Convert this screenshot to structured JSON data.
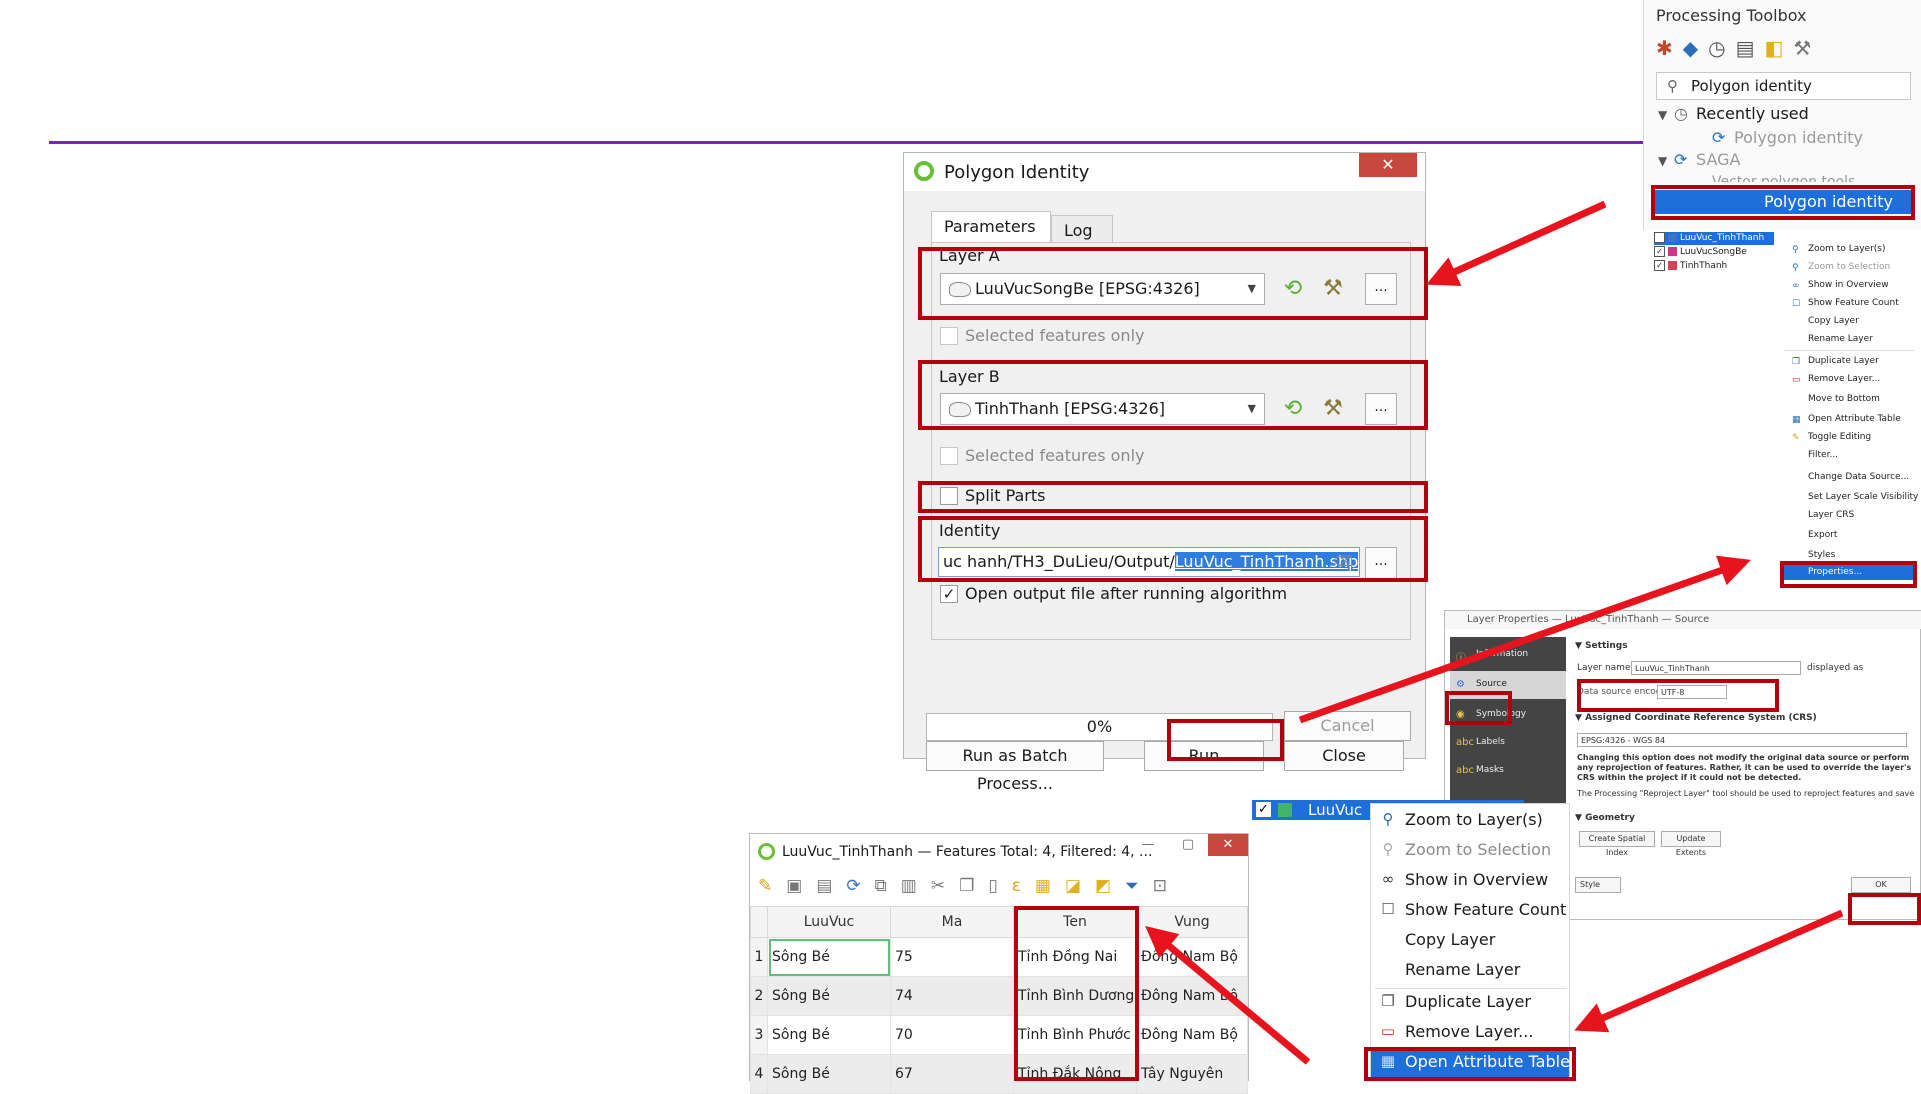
{
  "toolbox": {
    "title": "Processing Toolbox",
    "search_value": "Polygon identity",
    "recently_used": "Recently used",
    "recent_item": "Polygon identity",
    "saga": "SAGA",
    "vector_tools": "Vector polygon tools",
    "selected_item": "Polygon identity"
  },
  "layers_mini": {
    "rows": [
      "LuuVuc_TinhThanh",
      "LuuVucSongBe",
      "TinhThanh"
    ],
    "colors": [
      "#3a74c9",
      "#c33a8a",
      "#d24455"
    ]
  },
  "context_mini": {
    "items": [
      "Zoom to Layer(s)",
      "Zoom to Selection",
      "Show in Overview",
      "Show Feature Count",
      "Copy Layer",
      "Rename Layer",
      "Duplicate Layer",
      "Remove Layer...",
      "Move to Bottom",
      "Open Attribute Table",
      "Toggle Editing",
      "Filter...",
      "Change Data Source...",
      "Set Layer Scale Visibility",
      "Layer CRS",
      "Export",
      "Styles",
      "Properties..."
    ]
  },
  "dialog": {
    "title": "Polygon Identity",
    "close_glyph": "✕",
    "tabs": [
      "Parameters",
      "Log"
    ],
    "layer_a_label": "Layer A",
    "layer_a_value": "LuuVucSongBe [EPSG:4326]",
    "selected_only": "Selected features only",
    "layer_b_label": "Layer B",
    "layer_b_value": "TinhThanh [EPSG:4326]",
    "split_parts": "Split Parts",
    "identity_label": "Identity",
    "identity_path_prefix": "uc hanh/TH3_DuLieu/Output/",
    "identity_path_selected": "LuuVuc_TinhThanh.shp",
    "open_output": "Open output file after running algorithm",
    "ellipsis": "...",
    "progress": 0,
    "progress_text": "0%",
    "cancel": "Cancel",
    "run_batch": "Run as Batch Process...",
    "run": "Run",
    "close": "Close"
  },
  "attribute_table": {
    "title": "LuuVuc_TinhThanh — Features Total: 4, Filtered: 4, ...",
    "columns": [
      "LuuVuc",
      "Ma",
      "Ten",
      "Vung"
    ],
    "rows": [
      {
        "n": "1",
        "luuvuc": "Sông Bé",
        "ma": "75",
        "ten": "Tỉnh Đồng Nai",
        "vung": "Đông Nam Bộ"
      },
      {
        "n": "2",
        "luuvuc": "Sông Bé",
        "ma": "74",
        "ten": "Tỉnh Bình Dương",
        "vung": "Đông Nam Bộ"
      },
      {
        "n": "3",
        "luuvuc": "Sông Bé",
        "ma": "70",
        "ten": "Tỉnh Bình Phước",
        "vung": "Đông Nam Bộ"
      },
      {
        "n": "4",
        "luuvuc": "Sông Bé",
        "ma": "67",
        "ten": "Tỉnh Đắk Nông",
        "vung": "Tây Nguyên"
      }
    ]
  },
  "layer_properties": {
    "title": "Layer Properties — LuuVuc_TinhThanh — Source",
    "sidebar": [
      "Information",
      "Source",
      "Symbology",
      "Labels",
      "Masks"
    ],
    "settings": "Settings",
    "layer_name_label": "Layer name",
    "layer_name_value": "LuuVuc_TinhThanh",
    "displayed_as": "displayed as",
    "encoding_label": "Data source encoding",
    "encoding_value": "UTF-8",
    "crs_header": "Assigned Coordinate Reference System (CRS)",
    "crs_value": "EPSG:4326 - WGS 84",
    "crs_note": "Changing this option does not modify the original data source or perform any reprojection of features. Rather, it can be used to override the layer's CRS within the project if it could not be detected.",
    "crs_note2": "The Processing \"Reproject Layer\" tool should be used to reproject features and save to a new data source.",
    "geometry": "Geometry",
    "create_index": "Create Spatial Index",
    "update_extents": "Update Extents",
    "style": "Style",
    "ok": "OK"
  },
  "layers_bottom": {
    "name": "LuuVuc",
    "check": "✓"
  },
  "context_menu": {
    "zoom_layer": "Zoom to Layer(s)",
    "zoom_selection": "Zoom to Selection",
    "show_overview": "Show in Overview",
    "show_count": "Show Feature Count",
    "copy_layer": "Copy Layer",
    "rename_layer": "Rename Layer",
    "duplicate_layer": "Duplicate Layer",
    "remove_layer": "Remove Layer...",
    "open_attr": "Open Attribute Table"
  },
  "colors": {
    "annotation_red": "#e8141d",
    "box_red": "#b3000c",
    "accent_line": "#7a1fd6",
    "selection_blue": "#1e6fd9"
  }
}
